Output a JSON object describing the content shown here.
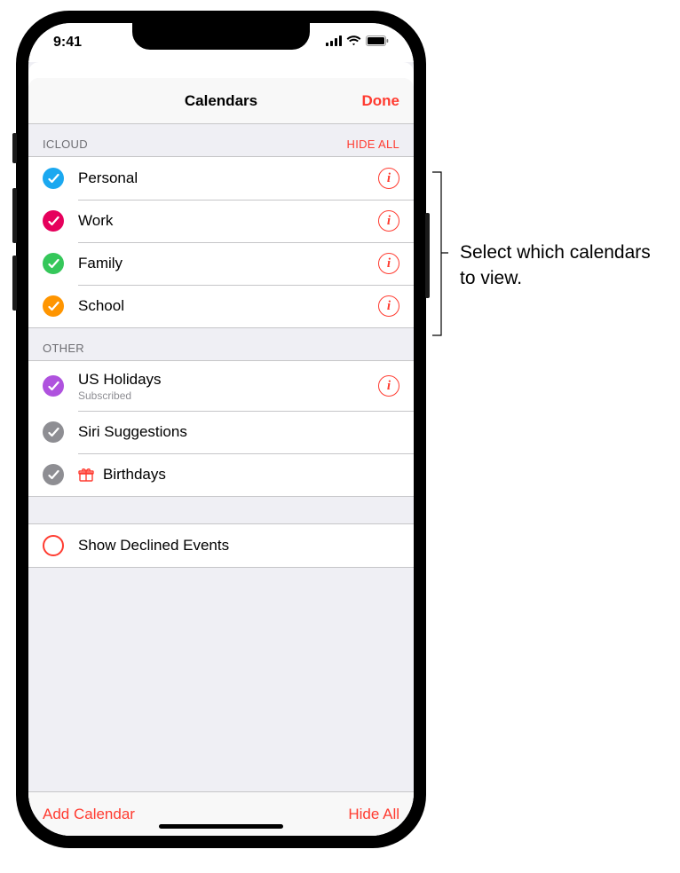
{
  "status": {
    "time": "9:41"
  },
  "nav": {
    "title": "Calendars",
    "done": "Done"
  },
  "sections": {
    "icloud": {
      "header": "ICLOUD",
      "action": "HIDE ALL",
      "items": [
        {
          "label": "Personal",
          "color": "#1ba8f0"
        },
        {
          "label": "Work",
          "color": "#e6005c"
        },
        {
          "label": "Family",
          "color": "#35c75a"
        },
        {
          "label": "School",
          "color": "#ff9500"
        }
      ]
    },
    "other": {
      "header": "OTHER",
      "items": [
        {
          "label": "US Holidays",
          "sublabel": "Subscribed",
          "color": "#af52de"
        },
        {
          "label": "Siri Suggestions",
          "color": "#8e8e93"
        },
        {
          "label": "Birthdays",
          "color": "#8e8e93"
        }
      ]
    },
    "declined": {
      "label": "Show Declined Events"
    }
  },
  "toolbar": {
    "add": "Add Calendar",
    "hideall": "Hide All"
  },
  "callout": "Select which calendars to view."
}
